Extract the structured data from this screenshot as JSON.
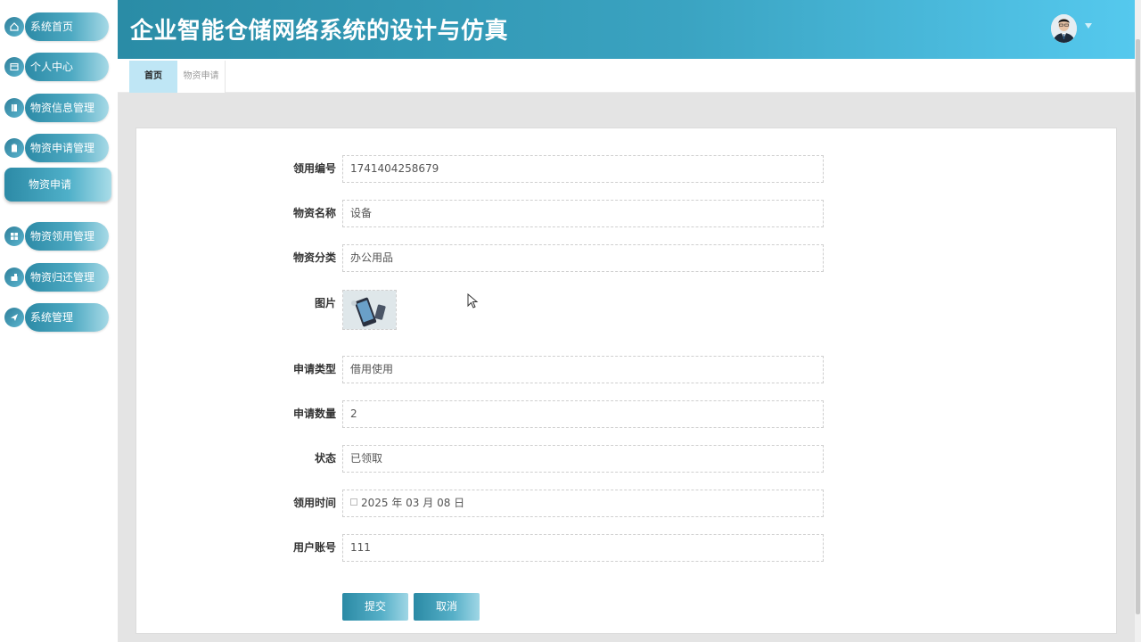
{
  "app": {
    "title": "企业智能仓储网络系统的设计与仿真"
  },
  "sidebar": {
    "items": [
      {
        "label": "系统首页",
        "icon": "home-icon"
      },
      {
        "label": "个人中心",
        "icon": "id-card-icon"
      },
      {
        "label": "物资信息管理",
        "icon": "book-icon"
      },
      {
        "label": "物资申请管理",
        "icon": "clipboard-icon"
      },
      {
        "label": "物资领用管理",
        "icon": "grid-icon"
      },
      {
        "label": "物资归还管理",
        "icon": "return-icon"
      },
      {
        "label": "系统管理",
        "icon": "send-icon"
      }
    ],
    "active_sub": "物资申请"
  },
  "tabs": {
    "home": "首页",
    "apply": "物资申请"
  },
  "form": {
    "code_label": "领用编号",
    "code_value": "1741404258679",
    "name_label": "物资名称",
    "name_value": "设备",
    "category_label": "物资分类",
    "category_value": "办公用品",
    "image_label": "图片",
    "type_label": "申请类型",
    "type_value": "借用使用",
    "qty_label": "申请数量",
    "qty_value": "2",
    "status_label": "状态",
    "status_value": "已领取",
    "time_label": "领用时间",
    "time_value": "2025 年 03 月 08 日",
    "account_label": "用户账号",
    "account_value": "111"
  },
  "buttons": {
    "submit": "提交",
    "cancel": "取消"
  },
  "colors": {
    "accent": "#2a8ca6",
    "header_end": "#55c9ee",
    "tab_active": "#bfe6f5"
  }
}
